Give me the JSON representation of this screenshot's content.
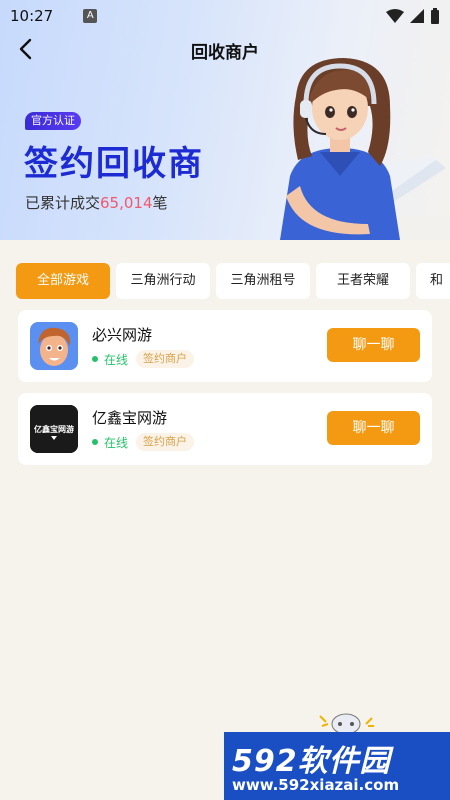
{
  "status_bar": {
    "time": "10:27",
    "indicator": "A"
  },
  "header": {
    "title": "回收商户"
  },
  "banner": {
    "badge": "官方认证",
    "title": "签约回收商",
    "stat_prefix": "已累计成交",
    "stat_count": "65,014",
    "stat_suffix": "笔"
  },
  "tabs": [
    {
      "label": "全部游戏",
      "active": true
    },
    {
      "label": "三角洲行动"
    },
    {
      "label": "三角洲租号"
    },
    {
      "label": "王者荣耀"
    },
    {
      "label": "和"
    }
  ],
  "merchants": [
    {
      "name": "必兴网游",
      "status": "在线",
      "tag": "签约商户",
      "action": "聊一聊"
    },
    {
      "name": "亿鑫宝网游",
      "status": "在线",
      "tag": "签约商户",
      "action": "聊一聊",
      "logo_text": "亿鑫宝网游"
    }
  ],
  "watermark": {
    "title": "592软件园",
    "url": "www.592xiazai.com"
  },
  "colors": {
    "accent": "#f39a12",
    "brand_blue": "#1d2bd3",
    "online": "#26c06a",
    "highlight": "#f0586c"
  }
}
